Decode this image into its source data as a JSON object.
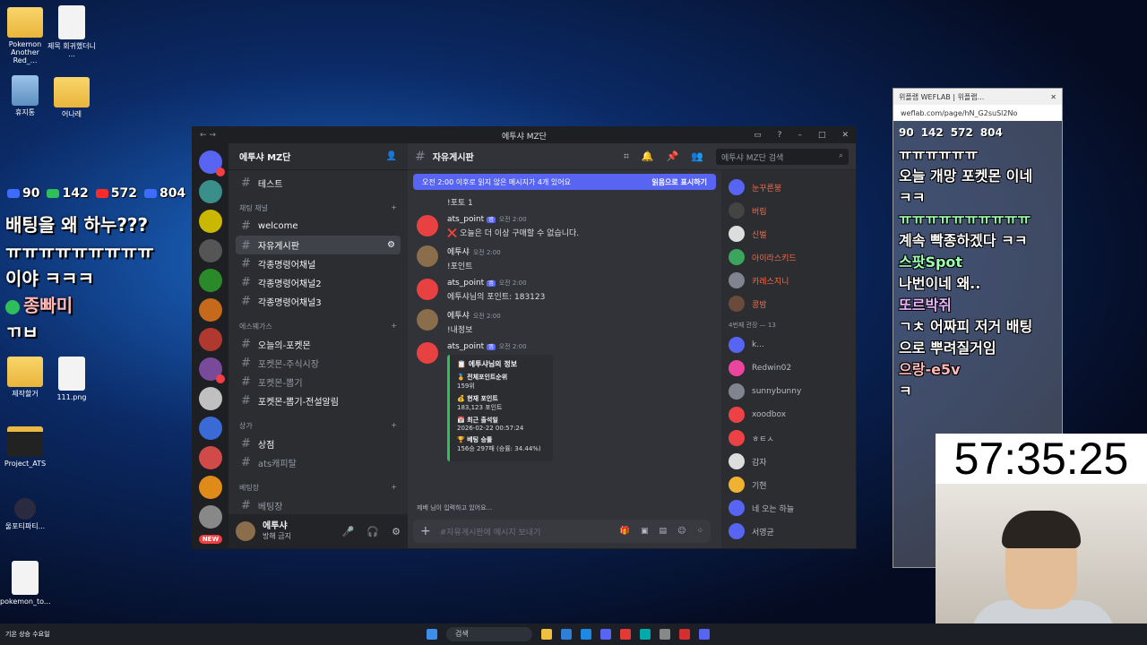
{
  "desktop": {
    "icons": [
      {
        "label": "Pokemon Another Red_..."
      },
      {
        "label": "제목 회귀했더니 ..."
      },
      {
        "label": "휴지통"
      },
      {
        "label": "어나레"
      },
      {
        "label": "제작할거"
      },
      {
        "label": "111.png"
      },
      {
        "label": "Project_ATS"
      },
      {
        "label": "울포티파티..."
      },
      {
        "label": "pokemon_to..."
      }
    ]
  },
  "overlay_left": {
    "stats": [
      "90",
      "142",
      "572",
      "804"
    ],
    "lines": [
      "배팅을 왜 하누???",
      "ㅠㅠㅠㅠㅠㅠㅠㅠㅠ",
      "이야 ㅋㅋㅋ",
      "종빠미",
      "ㄲㅂ"
    ]
  },
  "discord": {
    "window_title": "에투샤 MZ단",
    "server_name": "에투샤 MZ단",
    "top_channel": "테스트",
    "categories": [
      {
        "name": "채팅 채널",
        "channels": [
          {
            "name": "welcome",
            "style": "bright"
          },
          {
            "name": "자유게시판",
            "style": "active"
          },
          {
            "name": "각종명령어채널",
            "style": "bright"
          },
          {
            "name": "각종명령어채널2",
            "style": "bright"
          },
          {
            "name": "각종명령어채널3",
            "style": "bright"
          }
        ]
      },
      {
        "name": "에스붸가스",
        "channels": [
          {
            "name": "오늘의-포켓몬",
            "style": "bright"
          },
          {
            "name": "포켓몬-주식시장",
            "style": "muted"
          },
          {
            "name": "포켓몬-뽑기",
            "style": "muted"
          },
          {
            "name": "포켓몬-뽑기-전설알림",
            "style": "bright"
          }
        ]
      },
      {
        "name": "상가",
        "channels": [
          {
            "name": "상점",
            "style": "bright"
          },
          {
            "name": "ats캐피탈",
            "style": "muted"
          }
        ]
      },
      {
        "name": "베팅장",
        "channels": [
          {
            "name": "베팅장",
            "style": "muted"
          }
        ]
      }
    ],
    "user": {
      "name": "에투샤",
      "status": "방해 금지"
    },
    "channel_title": "자유게시판",
    "search_placeholder": "에투샤 MZ단 검색",
    "banner": {
      "text": "오전 2:00 이후로 읽지 않은 메시지가 4개 있어요",
      "action": "읽음으로 표시하기"
    },
    "messages": [
      {
        "author": "",
        "bot": false,
        "time": "",
        "text": "!포토 1"
      },
      {
        "author": "ats_point",
        "bot": true,
        "time": "오전 2:00",
        "text": "❌ 오늘은 더 이상 구매할 수 없습니다."
      },
      {
        "author": "에투샤",
        "bot": false,
        "time": "오전 2:00",
        "text": "!포인트"
      },
      {
        "author": "ats_point",
        "bot": true,
        "time": "오전 2:00",
        "text": "에투샤님의 포인트: 183123"
      },
      {
        "author": "에투샤",
        "bot": false,
        "time": "오전 2:00",
        "text": "!내정보"
      },
      {
        "author": "ats_point",
        "bot": true,
        "time": "오전 2:00",
        "text": ""
      }
    ],
    "bot_tag": "앱",
    "embed": {
      "title": "📋 에투샤님의 정보",
      "fields": [
        {
          "k": "🏅 전체포인트순위",
          "v": "159위"
        },
        {
          "k": "💰 현재 포인트",
          "v": "183,123 포인트"
        },
        {
          "k": "📅 최근 출석일",
          "v": "2026-02-22 00:57:24"
        },
        {
          "k": "🏆 베팅 승률",
          "v": "156승 297패 (승률: 34.44%)"
        }
      ]
    },
    "typing": "제베 님이 입력하고 있어요...",
    "composer_placeholder": "#자유게시판에 메시지 보내기",
    "members_top": [
      {
        "name": "눈꾸른붕",
        "color": "#f26a4b"
      },
      {
        "name": "버림",
        "color": "#f26a4b"
      },
      {
        "name": "신벌",
        "color": "#f26a4b"
      },
      {
        "name": "아이라스키드",
        "color": "#f26a4b"
      },
      {
        "name": "카레스지니",
        "color": "#f26a4b"
      },
      {
        "name": "콩밤",
        "color": "#f26a4b"
      }
    ],
    "member_category": "4번째 관장 — 13",
    "members_bottom": [
      {
        "name": "k...",
        "color": "#b5bac1"
      },
      {
        "name": "Redwin02",
        "color": "#b5bac1"
      },
      {
        "name": "sunnybunny",
        "color": "#b5bac1"
      },
      {
        "name": "xoodbox",
        "color": "#b5bac1"
      },
      {
        "name": "ㅎㅌㅅ",
        "color": "#b5bac1"
      },
      {
        "name": "감자",
        "color": "#b5bac1"
      },
      {
        "name": "기현",
        "color": "#b5bac1"
      },
      {
        "name": "네 오는 하늘",
        "color": "#b5bac1"
      },
      {
        "name": "서영균",
        "color": "#b5bac1"
      }
    ]
  },
  "chat_overlay": {
    "tab_title": "위플랩 WEFLAB | 위플랩...",
    "url": "weflab.com/page/hN_G2suSl2No",
    "stats": [
      "90",
      "142",
      "572",
      "804"
    ],
    "lines": [
      {
        "nick": "",
        "text": "ㅠㅠㅠㅠㅠㅠ"
      },
      {
        "nick": "",
        "text": "오늘 개망 포켓몬 이네"
      },
      {
        "nick": "",
        "text": "ㅋㅋ"
      },
      {
        "nick": "ㅠㅠㅠㅠㅠㅠㅠㅠㅠㅠ",
        "text": ""
      },
      {
        "nick": "",
        "text": "계속 빡종하겠다 ㅋㅋ"
      },
      {
        "nick": "스팟Spot",
        "text": ""
      },
      {
        "nick": "",
        "text": "나번이네 왜.."
      },
      {
        "nick": "또르박쥐",
        "text": ""
      },
      {
        "nick": "",
        "text": "ㄱㅊ 어짜피 저거 배팅"
      },
      {
        "nick": "",
        "text": "으로 뿌려질거임"
      },
      {
        "nick": "으랑-e5v",
        "text": ""
      },
      {
        "nick": "",
        "text": "ㅋ"
      }
    ]
  },
  "timer": "57:35:25",
  "taskbar": {
    "weather": "기온 상승 수요일",
    "search": "검색"
  }
}
